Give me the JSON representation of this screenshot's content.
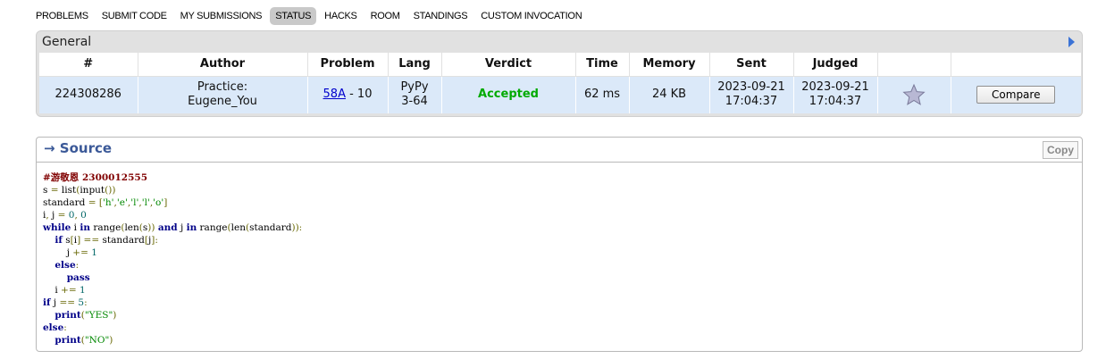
{
  "menu": {
    "items": [
      "PROBLEMS",
      "SUBMIT CODE",
      "MY SUBMISSIONS",
      "STATUS",
      "HACKS",
      "ROOM",
      "STANDINGS",
      "CUSTOM INVOCATION"
    ],
    "active_index": 3
  },
  "general": {
    "title": "General",
    "headers": [
      "#",
      "Author",
      "Problem",
      "Lang",
      "Verdict",
      "Time",
      "Memory",
      "Sent",
      "Judged"
    ],
    "row": {
      "id": "224308286",
      "author_line1": "Practice:",
      "author_line2": "Eugene_You",
      "problem_link": "58A",
      "problem_suffix": " - 10",
      "lang_line1": "PyPy",
      "lang_line2": "3-64",
      "verdict": "Accepted",
      "time": "62 ms",
      "memory": "24 KB",
      "sent_date": "2023-09-21",
      "sent_time": "17:04:37",
      "judged_date": "2023-09-21",
      "judged_time": "17:04:37",
      "compare_label": "Compare"
    }
  },
  "source": {
    "title": "→ Source",
    "copy_label": "Copy",
    "lines": [
      "#游敬恩 2300012555",
      "s = list(input())",
      "standard = ['h','e','l','l','o']",
      "i, j = 0, 0",
      "while i in range(len(s)) and j in range(len(standard)):",
      "    if s[i] == standard[j]:",
      "        j += 1",
      "    else:",
      "        pass",
      "    i += 1",
      "if j == 5:",
      "    print(\"YES\")",
      "else:",
      "    print(\"NO\")"
    ]
  },
  "colors": {
    "accent": "#3b5998",
    "row_bg": "#dbe9f9",
    "accepted": "#00aa00",
    "link": "#0000cc"
  },
  "icons": [
    "star-icon",
    "expand-arrow-icon"
  ]
}
